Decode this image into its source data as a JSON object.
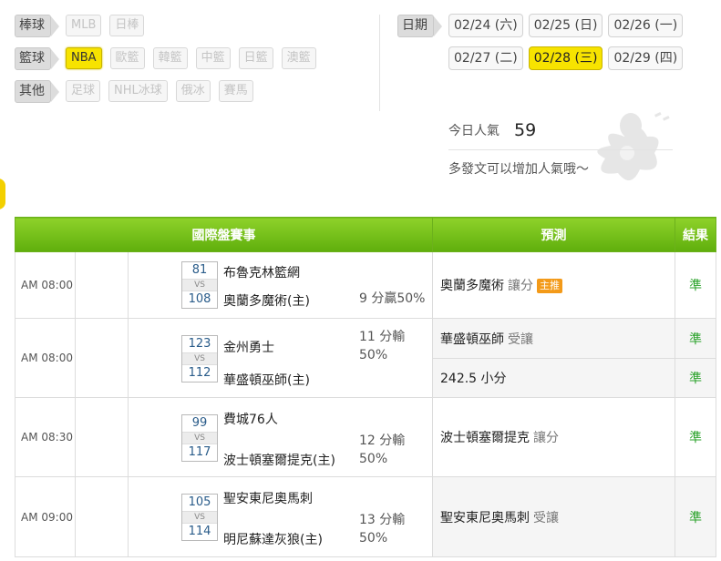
{
  "filters": [
    {
      "category": "棒球",
      "options": [
        {
          "label": "MLB",
          "active": false
        },
        {
          "label": "日棒",
          "active": false
        }
      ]
    },
    {
      "category": "籃球",
      "options": [
        {
          "label": "NBA",
          "active": true
        },
        {
          "label": "歐籃",
          "active": false
        },
        {
          "label": "韓籃",
          "active": false
        },
        {
          "label": "中籃",
          "active": false
        },
        {
          "label": "日籃",
          "active": false
        },
        {
          "label": "澳籃",
          "active": false
        }
      ]
    },
    {
      "category": "其他",
      "options": [
        {
          "label": "足球",
          "active": false
        },
        {
          "label": "NHL冰球",
          "active": false
        },
        {
          "label": "俄冰",
          "active": false
        },
        {
          "label": "賽馬",
          "active": false
        }
      ]
    }
  ],
  "dates": {
    "label": "日期",
    "rows": [
      [
        {
          "label": "02/24 (六)",
          "active": false
        },
        {
          "label": "02/25 (日)",
          "active": false
        },
        {
          "label": "02/26 (一)",
          "active": false
        }
      ],
      [
        {
          "label": "02/27 (二)",
          "active": false
        },
        {
          "label": "02/28 (三)",
          "active": true
        },
        {
          "label": "02/29 (四)",
          "active": false
        }
      ]
    ]
  },
  "popularity": {
    "label": "今日人氣",
    "count": "59",
    "hint": "多發文可以增加人氣哦～"
  },
  "table": {
    "headers": {
      "event": "國際盤賽事",
      "prediction": "預測",
      "result": "結果"
    },
    "games": [
      {
        "time": "AM 08:00",
        "away": {
          "score": "81",
          "name": "布魯克林籃網"
        },
        "vs": "VS",
        "home": {
          "score": "108",
          "name": "奧蘭多魔術(主)"
        },
        "line": "9 分贏50%",
        "picks": [
          {
            "team": "奧蘭多魔術",
            "type": "讓分",
            "badge": "主推",
            "result": "準"
          }
        ]
      },
      {
        "time": "AM 08:00",
        "away": {
          "score": "123",
          "name": "金州勇士"
        },
        "vs": "VS",
        "home": {
          "score": "112",
          "name": "華盛頓巫師(主)"
        },
        "line": "11 分輸 50%",
        "picks": [
          {
            "team": "華盛頓巫師",
            "type": "受讓",
            "badge": "",
            "result": "準"
          },
          {
            "team": "242.5 小分",
            "type": "",
            "badge": "",
            "result": "準"
          }
        ]
      },
      {
        "time": "AM 08:30",
        "away": {
          "score": "99",
          "name": "費城76人"
        },
        "vs": "VS",
        "home": {
          "score": "117",
          "name": "波士頓塞爾提克(主)"
        },
        "line": "12 分輸 50%",
        "picks": [
          {
            "team": "波士頓塞爾提克",
            "type": "讓分",
            "badge": "",
            "result": "準"
          }
        ]
      },
      {
        "time": "AM 09:00",
        "away": {
          "score": "105",
          "name": "聖安東尼奧馬刺"
        },
        "vs": "VS",
        "home": {
          "score": "114",
          "name": "明尼蘇達灰狼(主)"
        },
        "line": "13 分輸 50%",
        "picks": [
          {
            "team": "聖安東尼奧馬刺",
            "type": "受讓",
            "badge": "",
            "result": "準"
          }
        ]
      }
    ]
  }
}
